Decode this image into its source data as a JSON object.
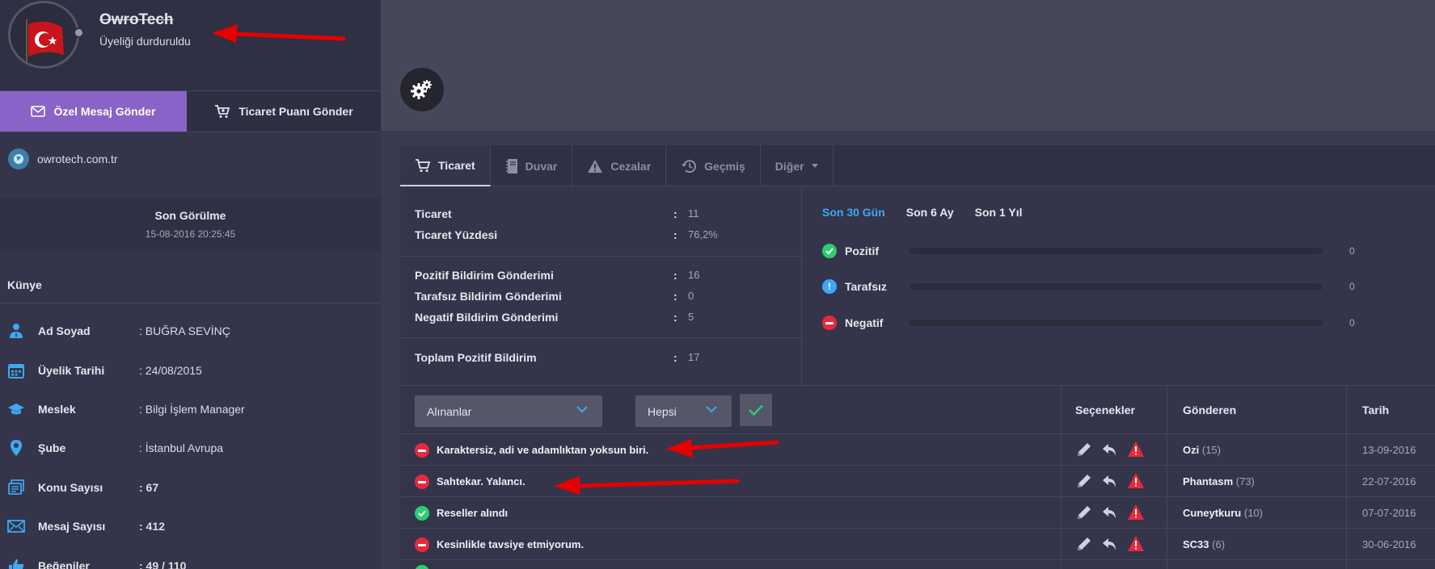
{
  "profile": {
    "username": "OwroTech",
    "membership_status": "Üyeliği durduruldu"
  },
  "actions": {
    "pm_label": "Özel Mesaj Gönder",
    "trade_label": "Ticaret Puanı Gönder"
  },
  "website": "owrotech.com.tr",
  "last_seen": {
    "title": "Son Görülme",
    "date": "15-08-2016 20:25:45"
  },
  "kunye": {
    "title": "Künye",
    "rows": [
      {
        "label": "Ad Soyad",
        "value": ": BUĞRA SEVİNÇ",
        "icon": "user-icon"
      },
      {
        "label": "Üyelik Tarihi",
        "value": ": 24/08/2015",
        "icon": "calendar-icon"
      },
      {
        "label": "Meslek",
        "value": ": Bilgi İşlem Manager",
        "icon": "graduation-cap-icon"
      },
      {
        "label": "Şube",
        "value": ": İstanbul Avrupa",
        "icon": "location-pin-icon"
      },
      {
        "label": "Konu Sayısı",
        "value": ": 67",
        "icon": "topics-icon"
      },
      {
        "label": "Mesaj Sayısı",
        "value": ": 412",
        "icon": "envelope-icon"
      },
      {
        "label": "Beğeniler",
        "value": ": 49 / 110",
        "icon": "thumbs-up-icon"
      }
    ]
  },
  "tabs": [
    {
      "label": "Ticaret",
      "icon": "cart-icon"
    },
    {
      "label": "Duvar",
      "icon": "notebook-icon"
    },
    {
      "label": "Cezalar",
      "icon": "warning-icon"
    },
    {
      "label": "Geçmiş",
      "icon": "history-icon"
    },
    {
      "label": "Diğer",
      "icon": "caret-down-icon"
    }
  ],
  "trade_stats": [
    {
      "label": "Ticaret",
      "sep": ":",
      "value": "11"
    },
    {
      "label": "Ticaret Yüzdesi",
      "sep": ":",
      "value": "76,2%"
    },
    {
      "label": "Pozitif Bildirim Gönderimi",
      "sep": ":",
      "value": "16"
    },
    {
      "label": "Tarafsız Bildirim Gönderimi",
      "sep": ":",
      "value": "0"
    },
    {
      "label": "Negatif Bildirim Gönderimi",
      "sep": ":",
      "value": "5"
    },
    {
      "label": "Toplam Pozitif Bildirim",
      "sep": ":",
      "value": "17"
    }
  ],
  "periods": [
    "Son 30 Gün",
    "Son 6 Ay",
    "Son 1 Yıl"
  ],
  "feedback_summary": [
    {
      "label": "Pozitif",
      "value": "0",
      "color": "#2ecc71",
      "fill": 0
    },
    {
      "label": "Tarafsız",
      "value": "0",
      "color": "#3ea8f5",
      "fill": 0
    },
    {
      "label": "Negatif",
      "value": "0",
      "color": "#e8283c",
      "fill": 0
    }
  ],
  "filters": {
    "received": "Alınanlar",
    "all": "Hepsi"
  },
  "columns": {
    "options": "Seçenekler",
    "sender": "Gönderen",
    "date": "Tarih"
  },
  "feedback_list": [
    {
      "type": "negative",
      "message": "Karaktersiz, adi ve adamlıktan yoksun biri.",
      "sender": "Ozi",
      "count": "(15)",
      "date": "13-09-2016"
    },
    {
      "type": "negative",
      "message": "Sahtekar. Yalancı.",
      "sender": "Phantasm",
      "count": "(73)",
      "date": "22-07-2016"
    },
    {
      "type": "positive",
      "message": "Reseller alındı",
      "sender": "Cuneytkuru",
      "count": "(10)",
      "date": "07-07-2016"
    },
    {
      "type": "negative",
      "message": "Kesinlikle tavsiye etmiyorum.",
      "sender": "SC33",
      "count": "(6)",
      "date": "30-06-2016"
    }
  ],
  "colors": {
    "accent": "#8a63c9",
    "positive": "#2ecc71",
    "negative": "#e8283c",
    "neutral": "#3ea8f5",
    "annotation_arrow": "#e60000"
  }
}
